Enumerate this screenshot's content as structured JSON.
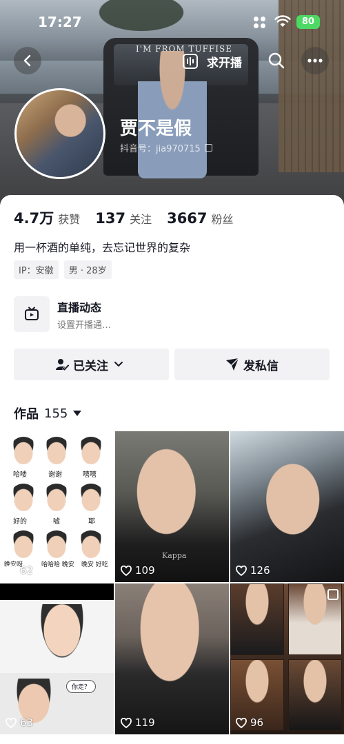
{
  "status_bar": {
    "time": "17:27",
    "battery": "80"
  },
  "cover": {
    "jeep_text": "I'M FROM TUFFISE"
  },
  "nav": {
    "live_request_label": "求开播"
  },
  "profile": {
    "name": "贾不是假",
    "handle": "抖音号：jia970715",
    "stats": [
      {
        "value": "4.7万",
        "label": "获赞"
      },
      {
        "value": "137",
        "label": "关注"
      },
      {
        "value": "3667",
        "label": "粉丝"
      }
    ],
    "bio": "用一杯酒的单纯，去忘记世界的复杂",
    "tags": [
      "IP：安徽",
      "男 · 28岁"
    ]
  },
  "live_feed": {
    "title": "直播动态",
    "subtitle": "设置开播通…"
  },
  "actions": {
    "follow_label": "已关注",
    "message_label": "发私信"
  },
  "works": {
    "label": "作品",
    "count": "155"
  },
  "videos": [
    {
      "likes": "62",
      "stickers": [
        "哈喽",
        "谢谢",
        "嘻嘻",
        "好的",
        "嘘",
        "耶",
        "晚安呀",
        "哈哈哈 晚安",
        "晚安 好吃"
      ]
    },
    {
      "likes": "109",
      "brand_text": "Kappa"
    },
    {
      "likes": "126"
    },
    {
      "likes": "63",
      "bubble": "你走？"
    },
    {
      "likes": "119"
    },
    {
      "likes": "96"
    }
  ]
}
